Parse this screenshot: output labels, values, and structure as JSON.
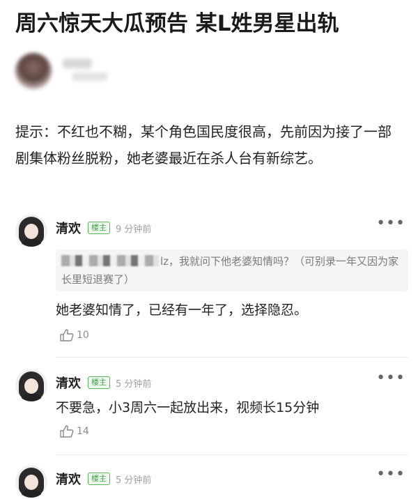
{
  "article": {
    "title": "周六惊天大瓜预告 某L姓男星出轨",
    "hint": "提示：不红也不糊，某个角色国民度很高，先前因为接了一部剧集体粉丝脱粉，她老婆最近在杀人台有新综艺。"
  },
  "comments": [
    {
      "name": "清欢",
      "badge": "楼主",
      "time": "9 分钟前",
      "more": "•••",
      "quote": "lz，我就问下他老婆知情吗？（可别录一年又因为家长里短退赛了）",
      "text": "她老婆知情了，已经有一年了，选择隐忍。",
      "likes": "10"
    },
    {
      "name": "清欢",
      "badge": "楼主",
      "time": "5 分钟前",
      "more": "•••",
      "text": "不要急，小3周六一起放出来，视频长15分钟",
      "likes": "14"
    },
    {
      "name": "清欢",
      "badge": "楼主",
      "time": "5 分钟前",
      "more": "•••"
    }
  ]
}
